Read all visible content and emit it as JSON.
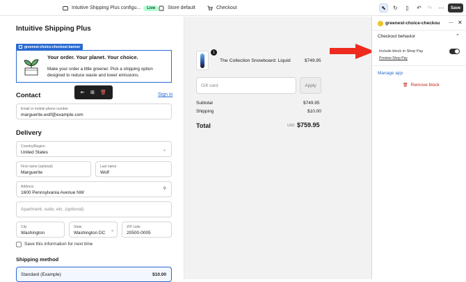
{
  "topbar": {
    "app_title": "Intuitive Shipping Plus configu...",
    "live_badge": "Live",
    "store_label": "Store default",
    "checkout_label": "Checkout",
    "save_label": "Save"
  },
  "shop": {
    "title": "Intuitive Shipping Plus"
  },
  "banner": {
    "tag": "greenest-choice-checkout-banner",
    "heading": "Your order. Your planet. Your choice.",
    "body": "Make your order a little greener. Pick a shipping option designed to reduce waste and lower emissions."
  },
  "contact": {
    "heading": "Contact",
    "signin": "Sign in",
    "email_label": "Email or mobile phone number",
    "email_value": "marguerite.wolf@example.com"
  },
  "delivery": {
    "heading": "Delivery",
    "country_label": "Country/Region",
    "country_value": "United States",
    "first_label": "First name (optional)",
    "first_value": "Marguerite",
    "last_label": "Last name",
    "last_value": "Wolf",
    "address_label": "Address",
    "address_value": "1600 Pennsylvania Avenue NW",
    "apt_placeholder": "Apartment, suite, etc. (optional)",
    "city_label": "City",
    "city_value": "Washington",
    "state_label": "State",
    "state_value": "Washington DC",
    "zip_label": "ZIP code",
    "zip_value": "20500-0005",
    "save_info": "Save this information for next time"
  },
  "shipping": {
    "heading": "Shipping method",
    "option_name": "Standard (Example)",
    "option_price": "$10.00"
  },
  "summary": {
    "qty": "1",
    "product": "The Collection Snowboard: Liquid",
    "product_price": "$749.95",
    "gift_placeholder": "Gift card",
    "apply": "Apply",
    "subtotal_label": "Subtotal",
    "subtotal_value": "$749.95",
    "shipping_label": "Shipping",
    "shipping_value": "$10.00",
    "total_label": "Total",
    "currency": "USD",
    "total_value": "$759.95"
  },
  "panel": {
    "title": "greenest-choice-checkou",
    "section": "Checkout behavior",
    "include_label": "Include block in Shop Pay",
    "preview_link": "Preview Shop Pay",
    "manage_app": "Manage app",
    "remove_block": "Remove block"
  },
  "colors": {
    "accent": "#2a6bd1",
    "annotation_arrow": "#ef2a1f",
    "live": "#b4fed2"
  }
}
